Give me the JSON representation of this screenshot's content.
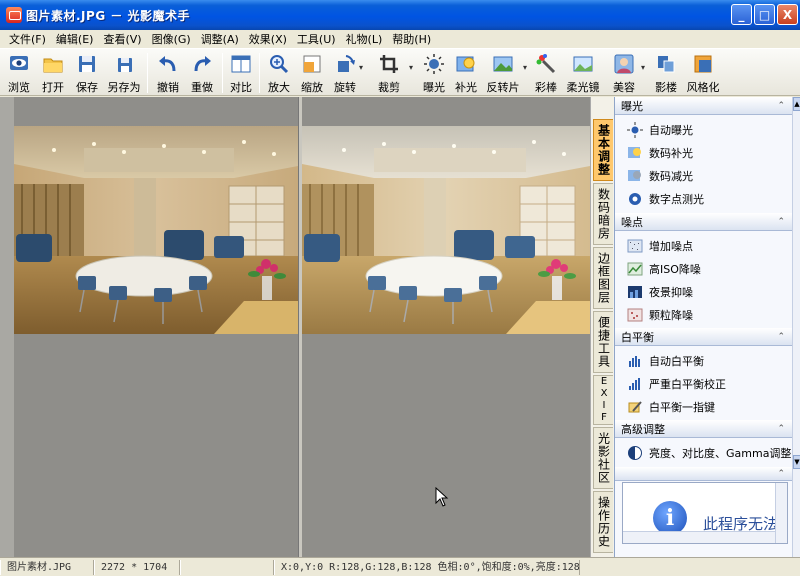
{
  "window": {
    "title": "图片素材.JPG － 光影魔术手",
    "minimize": "_",
    "maximize": "□",
    "close": "X"
  },
  "menu": [
    "文件(F)",
    "编辑(E)",
    "查看(V)",
    "图像(G)",
    "调整(A)",
    "效果(X)",
    "工具(U)",
    "礼物(L)",
    "帮助(H)"
  ],
  "toolbar": {
    "browse": "浏览",
    "open": "打开",
    "save": "保存",
    "save_as": "另存为",
    "undo": "撤销",
    "redo": "重做",
    "compare": "对比",
    "zoom_in": "放大",
    "scale": "缩放",
    "rotate": "旋转",
    "crop": "裁剪",
    "exposure": "曝光",
    "fill_light": "补光",
    "negative": "反转片",
    "color_stick": "彩棒",
    "soft_light": "柔光镜",
    "beauty": "美容",
    "shadow": "影楼",
    "style": "风格化"
  },
  "side_tabs": [
    "基本调整",
    "数码暗房",
    "边框图层",
    "便捷工具",
    "EXIF",
    "光影社区",
    "操作历史"
  ],
  "panel": {
    "panel_arrows": "⊪▸",
    "caret": "⌃",
    "groups": [
      {
        "title": "曝光",
        "items": [
          "自动曝光",
          "数码补光",
          "数码减光",
          "数字点测光"
        ]
      },
      {
        "title": "噪点",
        "items": [
          "增加噪点",
          "高ISO降噪",
          "夜景抑噪",
          "颗粒降噪"
        ]
      },
      {
        "title": "白平衡",
        "items": [
          "自动白平衡",
          "严重白平衡校正",
          "白平衡一指键"
        ]
      },
      {
        "title": "高级调整",
        "items": [
          "亮度、对比度、Gamma调整"
        ]
      }
    ],
    "info_icon": "i",
    "info_text": "此程序无法显"
  },
  "status": {
    "filename": "图片素材.JPG",
    "dimensions": "2272 * 1704",
    "pixel_info": "X:0,Y:0 R:128,G:128,B:128 色相:0°,饱和度:0%,亮度:128"
  }
}
